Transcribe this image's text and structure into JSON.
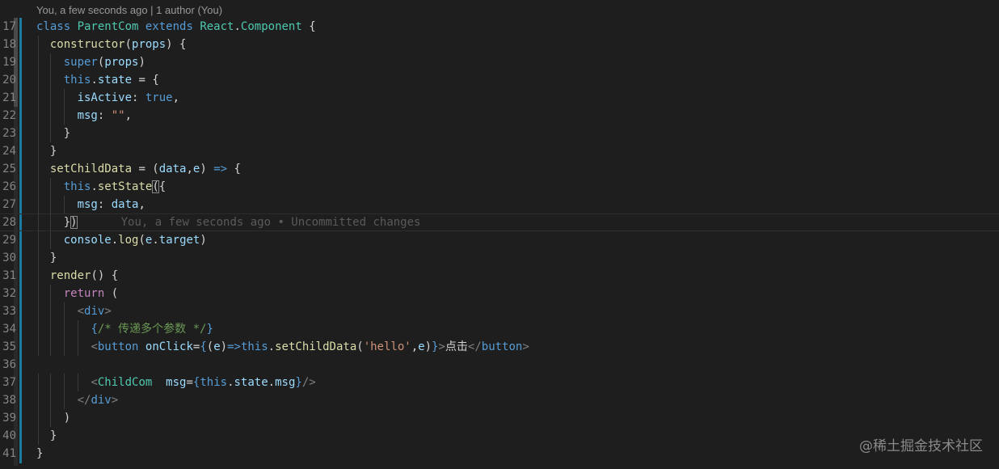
{
  "codelens": "You, a few seconds ago | 1 author (You)",
  "blame_inline": "You, a few seconds ago • Uncommitted changes",
  "watermark": "@稀土掘金技术社区",
  "current_line": 28,
  "lines": [
    {
      "n": "17",
      "tokens": [
        {
          "t": "class ",
          "c": "kw"
        },
        {
          "t": "ParentCom",
          "c": "cls"
        },
        {
          "t": " ",
          "c": "txt"
        },
        {
          "t": "extends",
          "c": "kw"
        },
        {
          "t": " ",
          "c": "txt"
        },
        {
          "t": "React",
          "c": "cls"
        },
        {
          "t": ".",
          "c": "txt"
        },
        {
          "t": "Component",
          "c": "cls"
        },
        {
          "t": " {",
          "c": "txt"
        }
      ]
    },
    {
      "n": "18",
      "tokens": [
        {
          "t": "  ",
          "c": "txt"
        },
        {
          "t": "constructor",
          "c": "fn"
        },
        {
          "t": "(",
          "c": "txt"
        },
        {
          "t": "props",
          "c": "var"
        },
        {
          "t": ") {",
          "c": "txt"
        }
      ]
    },
    {
      "n": "19",
      "tokens": [
        {
          "t": "    ",
          "c": "txt"
        },
        {
          "t": "super",
          "c": "kw"
        },
        {
          "t": "(",
          "c": "txt"
        },
        {
          "t": "props",
          "c": "var"
        },
        {
          "t": ")",
          "c": "txt"
        }
      ]
    },
    {
      "n": "20",
      "tokens": [
        {
          "t": "    ",
          "c": "txt"
        },
        {
          "t": "this",
          "c": "kw"
        },
        {
          "t": ".",
          "c": "txt"
        },
        {
          "t": "state",
          "c": "var"
        },
        {
          "t": " = {",
          "c": "txt"
        }
      ]
    },
    {
      "n": "21",
      "tokens": [
        {
          "t": "      ",
          "c": "txt"
        },
        {
          "t": "isActive",
          "c": "var"
        },
        {
          "t": ": ",
          "c": "txt"
        },
        {
          "t": "true",
          "c": "kw"
        },
        {
          "t": ",",
          "c": "txt"
        }
      ]
    },
    {
      "n": "22",
      "tokens": [
        {
          "t": "      ",
          "c": "txt"
        },
        {
          "t": "msg",
          "c": "var"
        },
        {
          "t": ": ",
          "c": "txt"
        },
        {
          "t": "\"\"",
          "c": "str"
        },
        {
          "t": ",",
          "c": "txt"
        }
      ]
    },
    {
      "n": "23",
      "tokens": [
        {
          "t": "    }",
          "c": "txt"
        }
      ]
    },
    {
      "n": "24",
      "tokens": [
        {
          "t": "  }",
          "c": "txt"
        }
      ]
    },
    {
      "n": "25",
      "tokens": [
        {
          "t": "  ",
          "c": "txt"
        },
        {
          "t": "setChildData",
          "c": "fn"
        },
        {
          "t": " = (",
          "c": "txt"
        },
        {
          "t": "data",
          "c": "var"
        },
        {
          "t": ",",
          "c": "txt"
        },
        {
          "t": "e",
          "c": "var"
        },
        {
          "t": ") ",
          "c": "txt"
        },
        {
          "t": "=>",
          "c": "kw"
        },
        {
          "t": " {",
          "c": "txt"
        }
      ]
    },
    {
      "n": "26",
      "tokens": [
        {
          "t": "    ",
          "c": "txt"
        },
        {
          "t": "this",
          "c": "kw"
        },
        {
          "t": ".",
          "c": "txt"
        },
        {
          "t": "setState",
          "c": "fn"
        },
        {
          "t": "(",
          "c": "brk-hl"
        },
        {
          "t": "{",
          "c": "txt"
        }
      ]
    },
    {
      "n": "27",
      "tokens": [
        {
          "t": "      ",
          "c": "txt"
        },
        {
          "t": "msg",
          "c": "var"
        },
        {
          "t": ": ",
          "c": "txt"
        },
        {
          "t": "data",
          "c": "var"
        },
        {
          "t": ",",
          "c": "txt"
        }
      ]
    },
    {
      "n": "28",
      "tokens": [
        {
          "t": "    }",
          "c": "txt"
        },
        {
          "t": ")",
          "c": "brk-hl"
        }
      ],
      "blame": true
    },
    {
      "n": "29",
      "tokens": [
        {
          "t": "    ",
          "c": "txt"
        },
        {
          "t": "console",
          "c": "var"
        },
        {
          "t": ".",
          "c": "txt"
        },
        {
          "t": "log",
          "c": "fn"
        },
        {
          "t": "(",
          "c": "txt"
        },
        {
          "t": "e",
          "c": "var"
        },
        {
          "t": ".",
          "c": "txt"
        },
        {
          "t": "target",
          "c": "var"
        },
        {
          "t": ")",
          "c": "txt"
        }
      ]
    },
    {
      "n": "30",
      "tokens": [
        {
          "t": "  }",
          "c": "txt"
        }
      ]
    },
    {
      "n": "31",
      "tokens": [
        {
          "t": "  ",
          "c": "txt"
        },
        {
          "t": "render",
          "c": "fn"
        },
        {
          "t": "() {",
          "c": "txt"
        }
      ]
    },
    {
      "n": "32",
      "tokens": [
        {
          "t": "    ",
          "c": "txt"
        },
        {
          "t": "return",
          "c": "ctl"
        },
        {
          "t": " (",
          "c": "txt"
        }
      ]
    },
    {
      "n": "33",
      "tokens": [
        {
          "t": "      ",
          "c": "txt"
        },
        {
          "t": "<",
          "c": "tagb"
        },
        {
          "t": "div",
          "c": "tag"
        },
        {
          "t": ">",
          "c": "tagb"
        }
      ]
    },
    {
      "n": "34",
      "tokens": [
        {
          "t": "        ",
          "c": "txt"
        },
        {
          "t": "{",
          "c": "kw"
        },
        {
          "t": "/* 传递多个参数 */",
          "c": "cm"
        },
        {
          "t": "}",
          "c": "kw"
        }
      ]
    },
    {
      "n": "35",
      "tokens": [
        {
          "t": "        ",
          "c": "txt"
        },
        {
          "t": "<",
          "c": "tagb"
        },
        {
          "t": "button",
          "c": "tag"
        },
        {
          "t": " ",
          "c": "txt"
        },
        {
          "t": "onClick",
          "c": "attr"
        },
        {
          "t": "=",
          "c": "txt"
        },
        {
          "t": "{",
          "c": "kw"
        },
        {
          "t": "(",
          "c": "txt"
        },
        {
          "t": "e",
          "c": "var"
        },
        {
          "t": ")",
          "c": "txt"
        },
        {
          "t": "=>",
          "c": "kw"
        },
        {
          "t": "this",
          "c": "kw"
        },
        {
          "t": ".",
          "c": "txt"
        },
        {
          "t": "setChildData",
          "c": "fn"
        },
        {
          "t": "(",
          "c": "txt"
        },
        {
          "t": "'hello'",
          "c": "str"
        },
        {
          "t": ",",
          "c": "txt"
        },
        {
          "t": "e",
          "c": "var"
        },
        {
          "t": ")",
          "c": "txt"
        },
        {
          "t": "}",
          "c": "kw"
        },
        {
          "t": ">",
          "c": "tagb"
        },
        {
          "t": "点击",
          "c": "txt"
        },
        {
          "t": "</",
          "c": "tagb"
        },
        {
          "t": "button",
          "c": "tag"
        },
        {
          "t": ">",
          "c": "tagb"
        }
      ]
    },
    {
      "n": "36",
      "tokens": []
    },
    {
      "n": "37",
      "tokens": [
        {
          "t": "        ",
          "c": "txt"
        },
        {
          "t": "<",
          "c": "tagb"
        },
        {
          "t": "ChildCom",
          "c": "cls"
        },
        {
          "t": "  ",
          "c": "txt"
        },
        {
          "t": "msg",
          "c": "attr"
        },
        {
          "t": "=",
          "c": "txt"
        },
        {
          "t": "{",
          "c": "kw"
        },
        {
          "t": "this",
          "c": "kw"
        },
        {
          "t": ".",
          "c": "txt"
        },
        {
          "t": "state",
          "c": "var"
        },
        {
          "t": ".",
          "c": "txt"
        },
        {
          "t": "msg",
          "c": "var"
        },
        {
          "t": "}",
          "c": "kw"
        },
        {
          "t": "/>",
          "c": "tagb"
        }
      ]
    },
    {
      "n": "38",
      "tokens": [
        {
          "t": "      ",
          "c": "txt"
        },
        {
          "t": "</",
          "c": "tagb"
        },
        {
          "t": "div",
          "c": "tag"
        },
        {
          "t": ">",
          "c": "tagb"
        }
      ]
    },
    {
      "n": "39",
      "tokens": [
        {
          "t": "    )",
          "c": "txt"
        }
      ]
    },
    {
      "n": "40",
      "tokens": [
        {
          "t": "  }",
          "c": "txt"
        }
      ]
    },
    {
      "n": "41",
      "tokens": [
        {
          "t": "}",
          "c": "txt"
        }
      ]
    }
  ]
}
